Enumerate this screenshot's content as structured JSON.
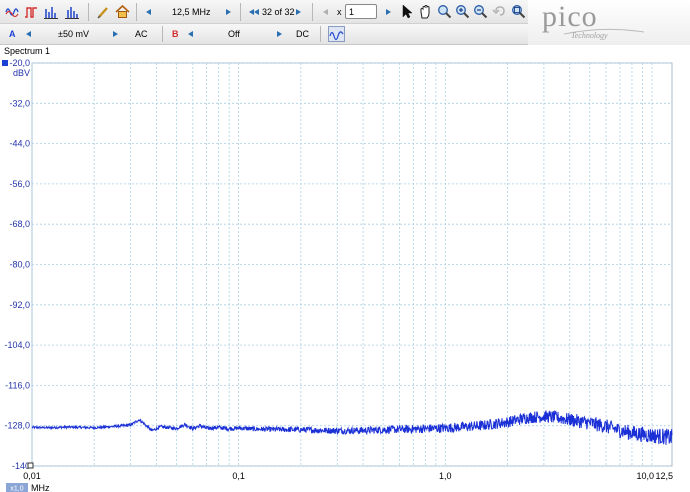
{
  "toolbar": {
    "timebase": "12,5 MHz",
    "buffer_position": "32 of 32",
    "multiplier_prefix": "x",
    "multiplier_value": "1"
  },
  "channels": [
    {
      "name": "A",
      "range": "±50 mV",
      "coupling": "AC",
      "color": "#1c3fd4"
    },
    {
      "name": "B",
      "range": "Off",
      "coupling": "DC",
      "color": "#d42c2c"
    }
  ],
  "logo": {
    "name": "pico",
    "subtitle": "Technology"
  },
  "view": {
    "title": "Spectrum 1"
  },
  "chart_data": {
    "type": "line",
    "x_scale": "log",
    "xlim": [
      0.01,
      12.5
    ],
    "ylim": [
      -140,
      -20
    ],
    "y_ticks": [
      "-20,0",
      "-32,0",
      "-44,0",
      "-56,0",
      "-68,0",
      "-80,0",
      "-92,0",
      "-104,0",
      "-116,0",
      "-128,0",
      "-140"
    ],
    "y_unit": "dBV",
    "x_ticks": [
      "0,01",
      "0,1",
      "1,0",
      "10,0",
      "12,5"
    ],
    "x_unit": "MHz",
    "x_scale_factor": "x1,0",
    "grid": true,
    "series": [
      {
        "color": "#1a2fd6",
        "x": [
          0.01,
          0.012,
          0.015,
          0.02,
          0.025,
          0.03,
          0.033,
          0.035,
          0.038,
          0.042,
          0.05,
          0.055,
          0.06,
          0.065,
          0.07,
          0.08,
          0.09,
          0.1,
          0.12,
          0.15,
          0.2,
          0.3,
          0.4,
          0.5,
          0.7,
          1.0,
          1.5,
          2.0,
          2.5,
          3.0,
          3.5,
          4.0,
          5.0,
          6.0,
          7.0,
          8.0,
          10.0,
          12.5
        ],
        "y": [
          -128.5,
          -128.6,
          -128.4,
          -128.6,
          -128.2,
          -127.8,
          -126.2,
          -127.5,
          -129.5,
          -128.3,
          -128.8,
          -127.6,
          -128.9,
          -128.0,
          -128.8,
          -128.5,
          -128.9,
          -128.7,
          -129.0,
          -129.1,
          -129.2,
          -129.5,
          -129.4,
          -129.2,
          -129.0,
          -128.7,
          -128.0,
          -126.9,
          -125.6,
          -125.2,
          -125.6,
          -126.2,
          -127.2,
          -128.2,
          -129.4,
          -130.2,
          -130.9,
          -131.5
        ]
      }
    ]
  }
}
